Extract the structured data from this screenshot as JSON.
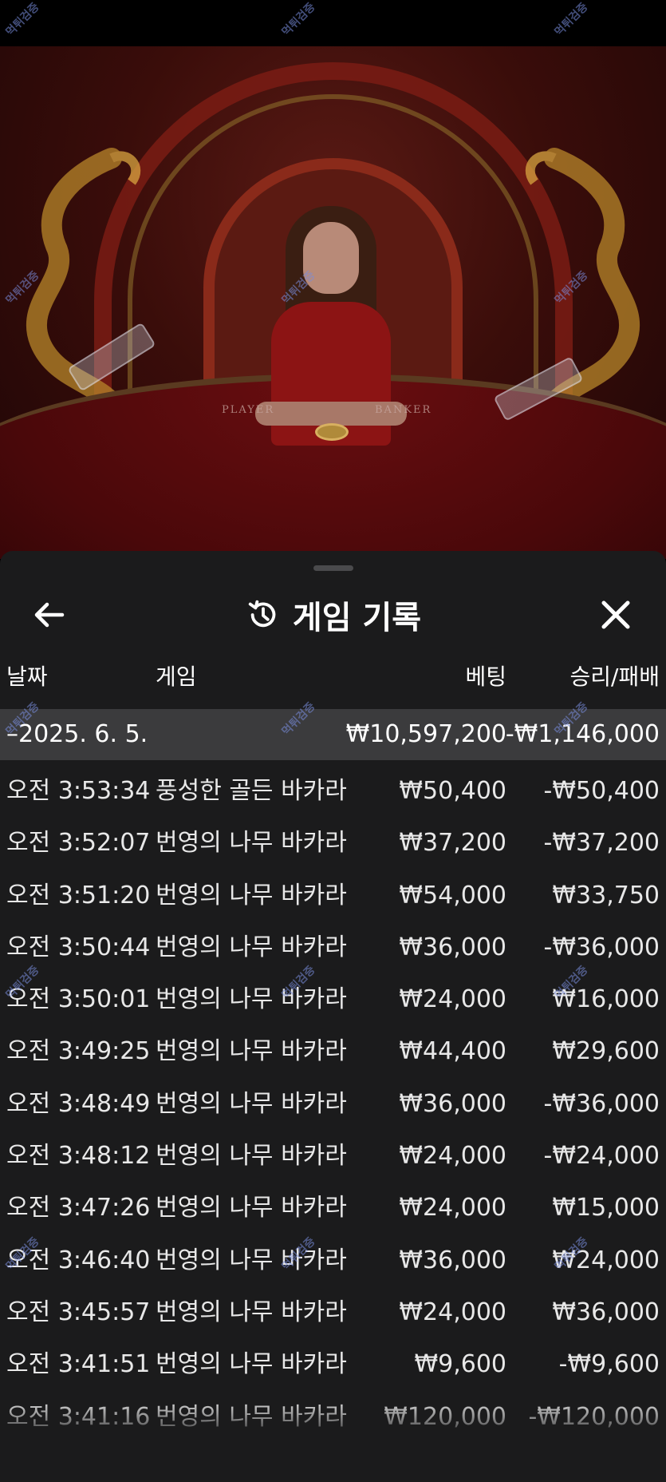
{
  "header": {
    "title": "게임 기록",
    "back_icon": "arrow-left-icon",
    "history_icon": "history-icon",
    "close_icon": "close-icon"
  },
  "columns": {
    "date": "날짜",
    "game": "게임",
    "bet": "베팅",
    "result": "승리/패배"
  },
  "group": {
    "date": "–2025. 6. 5.",
    "bet": "₩10,597,200",
    "result": "-₩1,146,000"
  },
  "rows": [
    {
      "time": "오전 3:53:34",
      "game": "풍성한 골든 바카라",
      "bet": "₩50,400",
      "result": "-₩50,400"
    },
    {
      "time": "오전 3:52:07",
      "game": "번영의 나무 바카라",
      "bet": "₩37,200",
      "result": "-₩37,200"
    },
    {
      "time": "오전 3:51:20",
      "game": "번영의 나무 바카라",
      "bet": "₩54,000",
      "result": "₩33,750"
    },
    {
      "time": "오전 3:50:44",
      "game": "번영의 나무 바카라",
      "bet": "₩36,000",
      "result": "-₩36,000"
    },
    {
      "time": "오전 3:50:01",
      "game": "번영의 나무 바카라",
      "bet": "₩24,000",
      "result": "₩16,000"
    },
    {
      "time": "오전 3:49:25",
      "game": "번영의 나무 바카라",
      "bet": "₩44,400",
      "result": "₩29,600"
    },
    {
      "time": "오전 3:48:49",
      "game": "번영의 나무 바카라",
      "bet": "₩36,000",
      "result": "-₩36,000"
    },
    {
      "time": "오전 3:48:12",
      "game": "번영의 나무 바카라",
      "bet": "₩24,000",
      "result": "-₩24,000"
    },
    {
      "time": "오전 3:47:26",
      "game": "번영의 나무 바카라",
      "bet": "₩24,000",
      "result": "₩15,000"
    },
    {
      "time": "오전 3:46:40",
      "game": "번영의 나무 바카라",
      "bet": "₩36,000",
      "result": "₩24,000"
    },
    {
      "time": "오전 3:45:57",
      "game": "번영의 나무 바카라",
      "bet": "₩24,000",
      "result": "₩36,000"
    },
    {
      "time": "오전 3:41:51",
      "game": "번영의 나무 바카라",
      "bet": "₩9,600",
      "result": "-₩9,600"
    },
    {
      "time": "오전 3:41:16",
      "game": "번영의 나무 바카라",
      "bet": "₩120,000",
      "result": "-₩120,000"
    }
  ],
  "video": {
    "player_label": "PLAYER",
    "banker_label": "BANKER"
  },
  "watermark": "먹튀검증",
  "colors": {
    "panel_bg": "#1b1b1c",
    "group_row_bg": "#3b3b3d",
    "text": "#ffffff"
  }
}
